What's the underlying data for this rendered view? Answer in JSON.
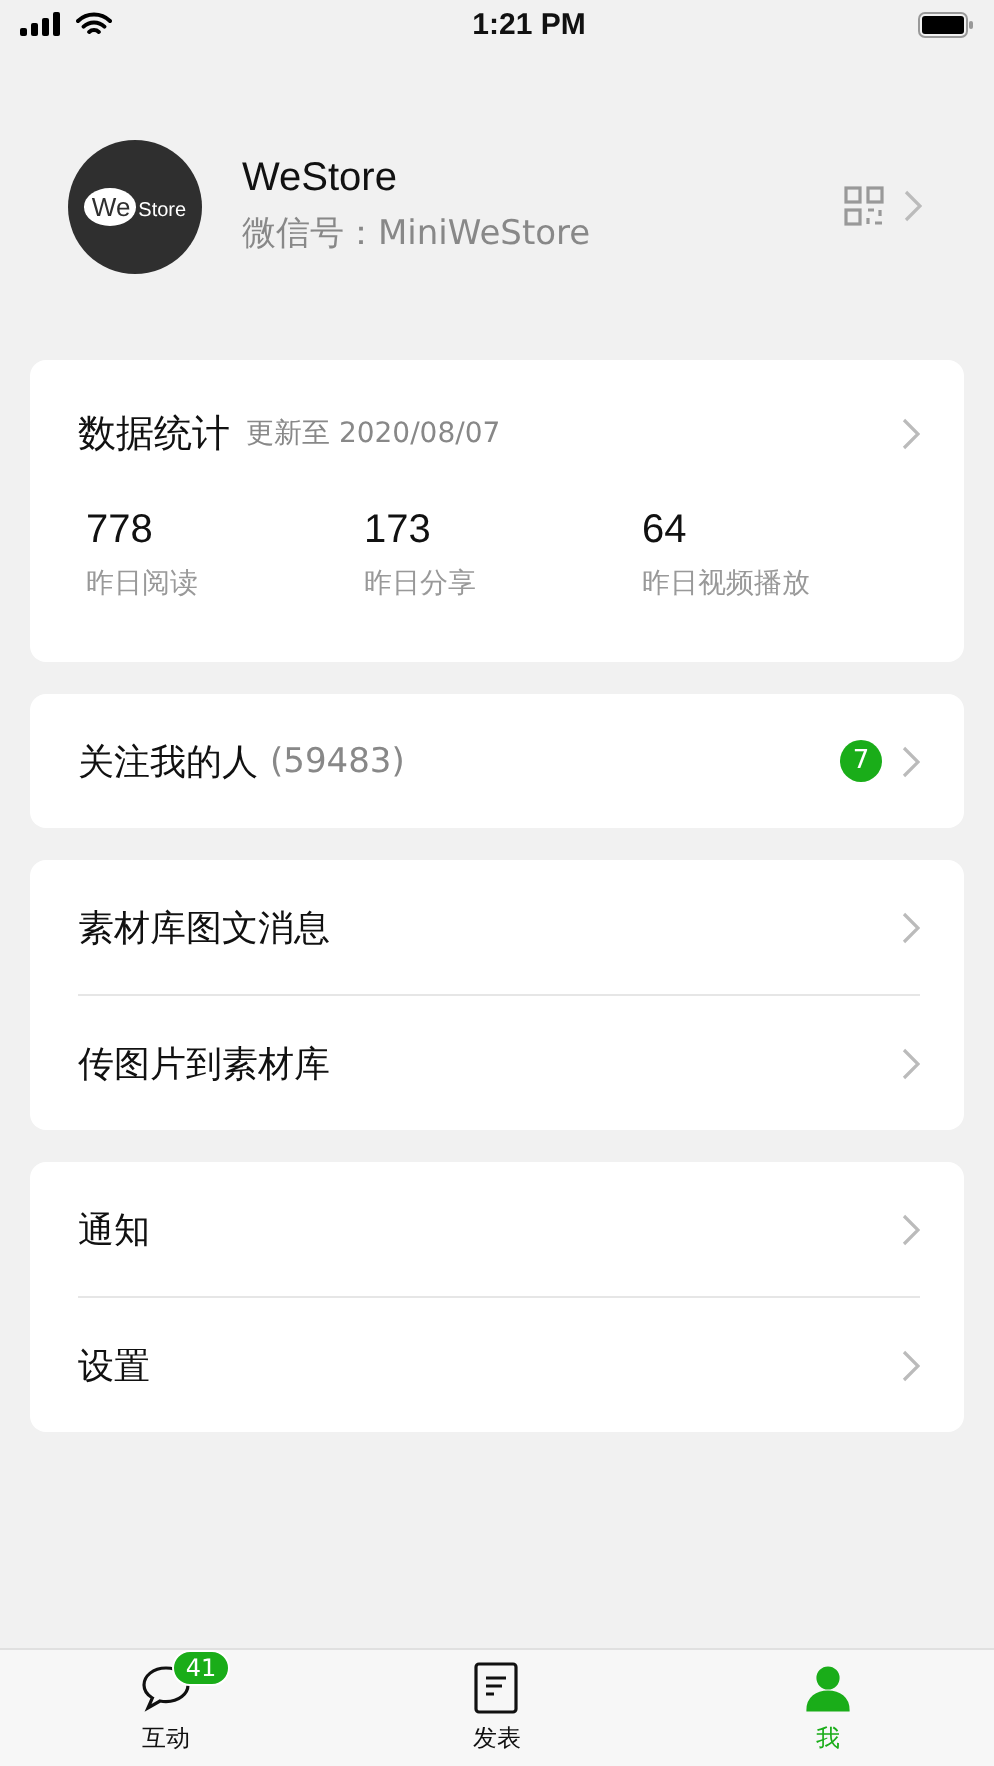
{
  "status_bar": {
    "time": "1:21 PM"
  },
  "profile": {
    "logo_words": [
      "We",
      "Store"
    ],
    "name": "WeStore",
    "wechat_id_label": "微信号：",
    "wechat_id": "MiniWeStore"
  },
  "stats": {
    "title": "数据统计",
    "updated": "更新至 2020/08/07",
    "items": [
      {
        "value": "778",
        "label": "昨日阅读"
      },
      {
        "value": "173",
        "label": "昨日分享"
      },
      {
        "value": "64",
        "label": "昨日视频播放"
      }
    ]
  },
  "groups": [
    [
      {
        "label": "关注我的人",
        "count": "(59483)",
        "badge": "7"
      }
    ],
    [
      {
        "label": "素材库图文消息"
      },
      {
        "label": "传图片到素材库"
      }
    ],
    [
      {
        "label": "通知"
      },
      {
        "label": "设置"
      }
    ]
  ],
  "tabs": [
    {
      "kind": "chat",
      "label": "互动",
      "badge": "41",
      "selected": false
    },
    {
      "kind": "doc",
      "label": "发表",
      "selected": false
    },
    {
      "kind": "person",
      "label": "我",
      "selected": true
    }
  ]
}
